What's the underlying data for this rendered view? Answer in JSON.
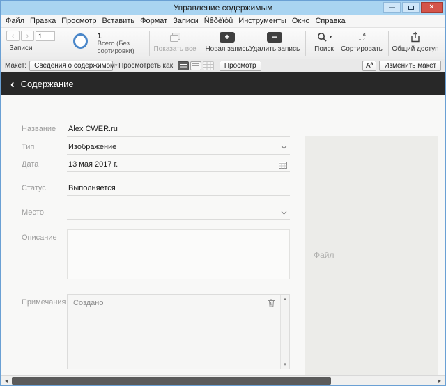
{
  "window": {
    "title": "Управление содержимым"
  },
  "menu": {
    "items": [
      "Файл",
      "Правка",
      "Просмотр",
      "Вставить",
      "Формат",
      "Записи",
      "Ñêðèïòû",
      "Инструменты",
      "Окно",
      "Справка"
    ]
  },
  "toolbar": {
    "records_group_label": "Записи",
    "current_record": "1",
    "found_count": "1",
    "found_label": "Всего (Без сортировки)",
    "show_all_label": "Показать все",
    "new_record_label": "Новая запись",
    "delete_record_label": "Удалить запись",
    "find_label": "Поиск",
    "sort_label": "Сортировать",
    "share_label": "Общий доступ"
  },
  "layout_bar": {
    "layout_label": "Макет:",
    "layout_value": "Сведения о содержимом",
    "view_as_label": "Просмотреть как:",
    "preview_label": "Просмотр",
    "format_button_label": "Aª",
    "edit_layout_label": "Изменить макет"
  },
  "header": {
    "title": "Содержание"
  },
  "form": {
    "fields": [
      {
        "label": "Название",
        "value": "Alex CWER.ru"
      },
      {
        "label": "Тип",
        "value": "Изображение"
      },
      {
        "label": "Дата",
        "value": "13 мая 2017 г."
      },
      {
        "label": "Статус",
        "value": "Выполняется"
      },
      {
        "label": "Место",
        "value": ""
      },
      {
        "label": "Описание",
        "value": ""
      }
    ],
    "notes": {
      "label": "Примечания",
      "entries": [
        "Создано"
      ]
    },
    "file_panel_label": "Файл"
  },
  "icons": {
    "back_chevron": "‹",
    "forward_chevron": "›",
    "header_back": "‹",
    "minimize": "—",
    "close": "×",
    "plus": "+",
    "minus": "−",
    "caret_down": "▾",
    "sort_arrow": "↓",
    "sort_a": "a",
    "sort_z": "z",
    "scroll_up": "▴",
    "scroll_down": "▾",
    "scroll_left": "◂",
    "scroll_right": "▸"
  },
  "colors": {
    "titlebar": "#a9d4f1",
    "close_button": "#d4544a",
    "pie_accent": "#4b87c9",
    "header_bg": "#282828"
  }
}
